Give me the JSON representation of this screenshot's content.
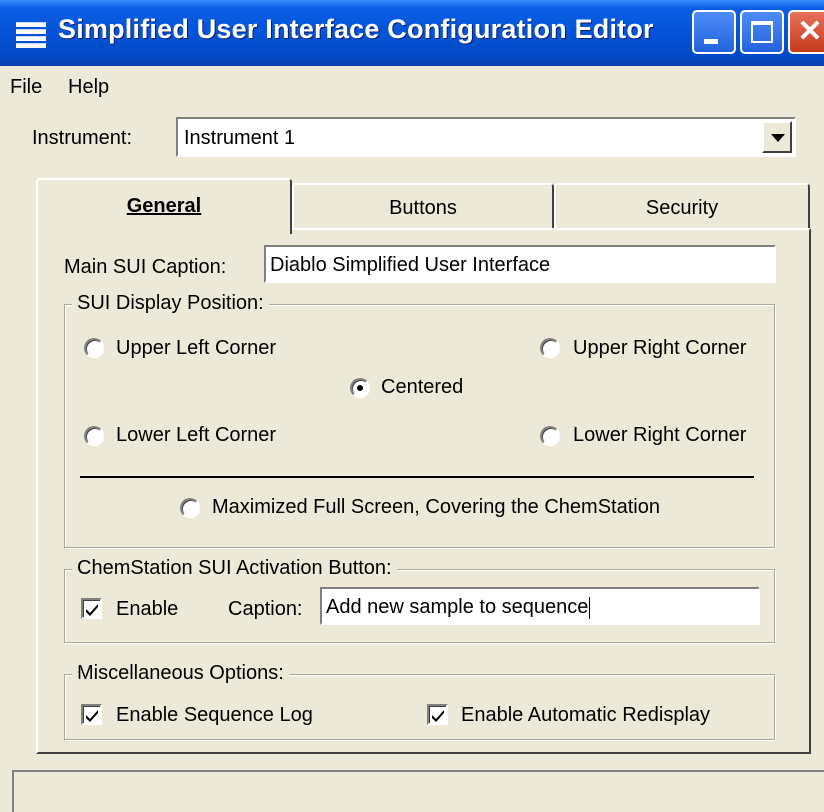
{
  "window": {
    "title": "Simplified User Interface Configuration Editor"
  },
  "menu": {
    "items": [
      "File",
      "Help"
    ]
  },
  "instrument": {
    "label": "Instrument:",
    "value": "Instrument 1"
  },
  "tabs": [
    {
      "label": "General",
      "active": true
    },
    {
      "label": "Buttons",
      "active": false
    },
    {
      "label": "Security",
      "active": false
    }
  ],
  "general": {
    "main_caption_label": "Main SUI Caption:",
    "main_caption_value": "Diablo Simplified User Interface",
    "display_position": {
      "title": "SUI Display Position:",
      "options": {
        "upper_left": "Upper Left Corner",
        "upper_right": "Upper Right Corner",
        "centered": "Centered",
        "lower_left": "Lower Left Corner",
        "lower_right": "Lower Right Corner",
        "maximized": "Maximized Full Screen, Covering the ChemStation"
      },
      "selected": "Centered"
    },
    "activation_button": {
      "title": "ChemStation SUI Activation Button:",
      "enable_label": "Enable",
      "enable_checked": true,
      "caption_label": "Caption:",
      "caption_value": "Add new sample to sequence"
    },
    "misc": {
      "title": "Miscellaneous Options:",
      "sequence_log_label": "Enable Sequence Log",
      "sequence_log_checked": true,
      "auto_redisplay_label": "Enable Automatic Redisplay",
      "auto_redisplay_checked": true
    }
  },
  "icons": {
    "system_menu": "window-menu-icon",
    "minimize": "minimize-icon",
    "maximize": "maximize-icon",
    "close": "close-icon",
    "dropdown": "dropdown-arrow-icon",
    "checkmark": "checkmark-icon"
  },
  "colors": {
    "titlebar": "#0453d8",
    "face": "#ece9d8",
    "close_button": "#c73a1c"
  }
}
